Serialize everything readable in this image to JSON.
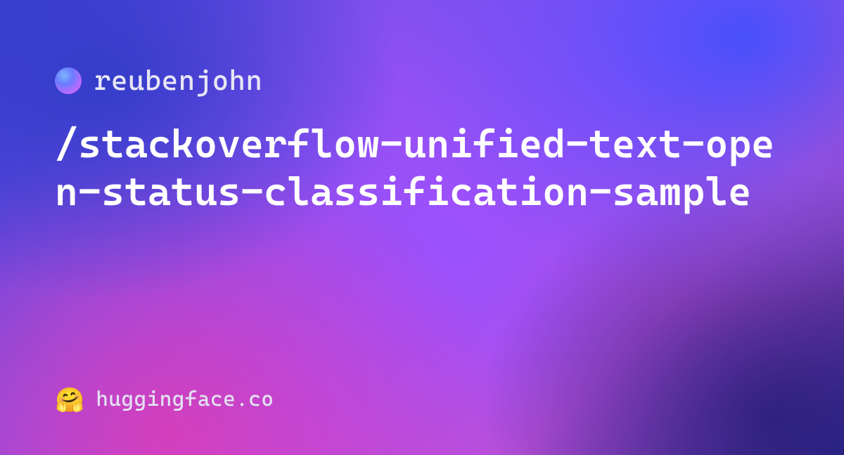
{
  "owner": {
    "name": "reubenjohn"
  },
  "repo": {
    "path": "/stackoverflow-unified-text-open-status-classification-sample"
  },
  "footer": {
    "emoji": "🤗",
    "site": "huggingface.co"
  }
}
